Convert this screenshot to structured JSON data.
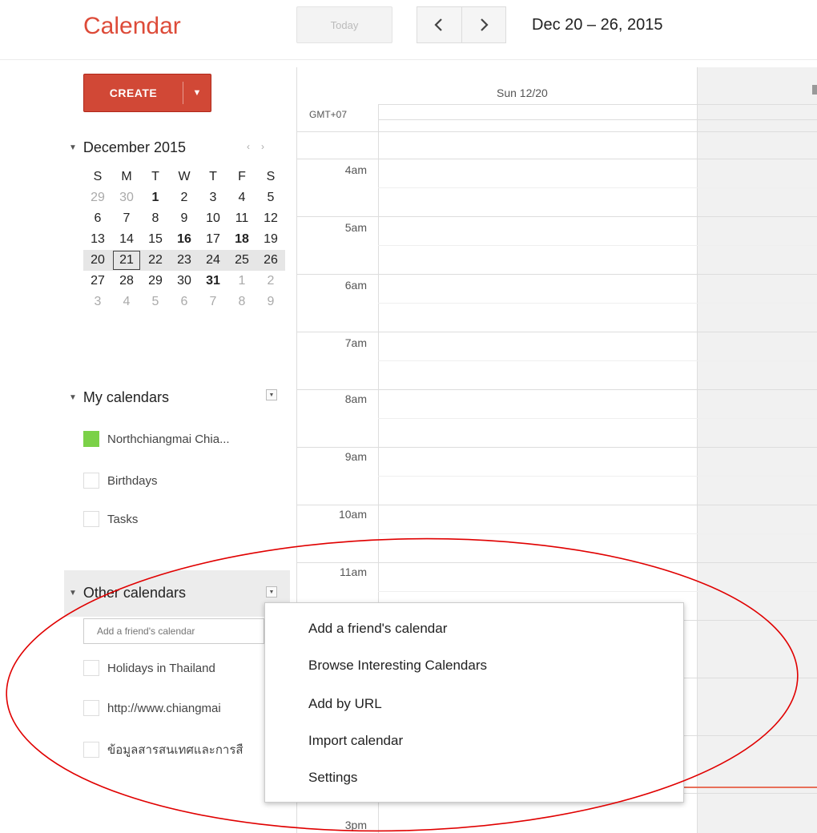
{
  "header": {
    "title": "Calendar",
    "today_label": "Today",
    "prev_icon": "chevron-left-icon",
    "next_icon": "chevron-right-icon",
    "date_range": "Dec 20 – 26, 2015"
  },
  "create": {
    "label": "CREATE",
    "dropdown_icon": "caret-down-icon",
    "color": "#d14836"
  },
  "mini_calendar": {
    "month_label": "December 2015",
    "weekday_headers": [
      "S",
      "M",
      "T",
      "W",
      "T",
      "F",
      "S"
    ],
    "weeks": [
      [
        "29",
        "30",
        "1",
        "2",
        "3",
        "4",
        "5"
      ],
      [
        "6",
        "7",
        "8",
        "9",
        "10",
        "11",
        "12"
      ],
      [
        "13",
        "14",
        "15",
        "16",
        "17",
        "18",
        "19"
      ],
      [
        "20",
        "21",
        "22",
        "23",
        "24",
        "25",
        "26"
      ],
      [
        "27",
        "28",
        "29",
        "30",
        "31",
        "1",
        "2"
      ],
      [
        "3",
        "4",
        "5",
        "6",
        "7",
        "8",
        "9"
      ]
    ],
    "selected_day": "21"
  },
  "my_calendars": {
    "title": "My calendars",
    "items": [
      {
        "label": "Northchiangmai Chia...",
        "color": "#7bd148",
        "checked": true
      },
      {
        "label": "Birthdays",
        "checked": false
      },
      {
        "label": "Tasks",
        "checked": false
      }
    ]
  },
  "other_calendars": {
    "title": "Other calendars",
    "input_placeholder": "Add a friend's calendar",
    "items": [
      {
        "label": "Holidays in Thailand"
      },
      {
        "label": "http://www.chiangmai"
      },
      {
        "label": "ข้อมูลสารสนเทศและการสื"
      }
    ]
  },
  "grid": {
    "day_header": "Sun 12/20",
    "timezone": "GMT+07",
    "hours": [
      "4am",
      "5am",
      "6am",
      "7am",
      "8am",
      "9am",
      "10am",
      "11am"
    ],
    "partial_hour": "3pm"
  },
  "popup_menu": {
    "items": [
      "Add a friend's calendar",
      "Browse Interesting Calendars",
      "Add by URL",
      "Import calendar",
      "Settings"
    ]
  },
  "annotation": {
    "color": "#e00000"
  }
}
